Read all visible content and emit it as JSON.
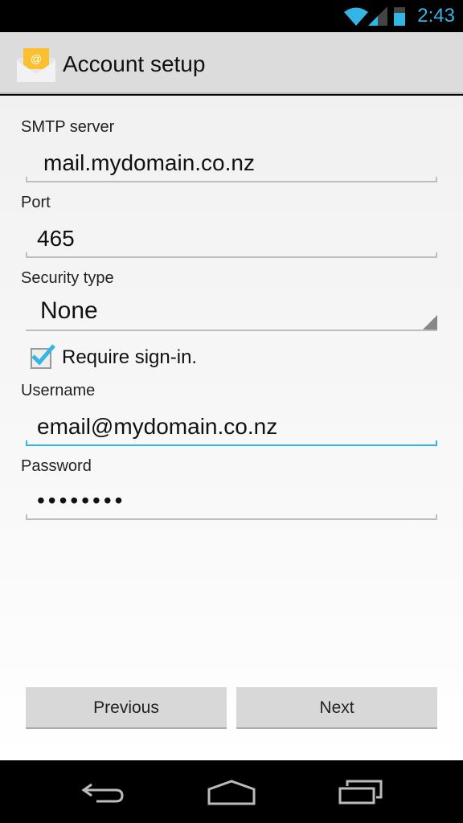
{
  "status_bar": {
    "time": "2:43",
    "icons": [
      "wifi-icon",
      "signal-icon",
      "battery-icon"
    ],
    "accent": "#33b5e5"
  },
  "action_bar": {
    "title": "Account setup",
    "icon": "email-app-icon"
  },
  "form": {
    "smtp_label": "SMTP server",
    "smtp_value": "mail.mydomain.co.nz",
    "port_label": "Port",
    "port_value": "465",
    "security_label": "Security type",
    "security_value": "None",
    "require_signin_label": "Require sign-in.",
    "require_signin_checked": true,
    "username_label": "Username",
    "username_value": "email@mydomain.co.nz",
    "password_label": "Password",
    "password_value": "••••••••"
  },
  "buttons": {
    "previous": "Previous",
    "next": "Next"
  },
  "nav_bar": {
    "icons": [
      "back-icon",
      "home-icon",
      "recent-apps-icon"
    ]
  }
}
